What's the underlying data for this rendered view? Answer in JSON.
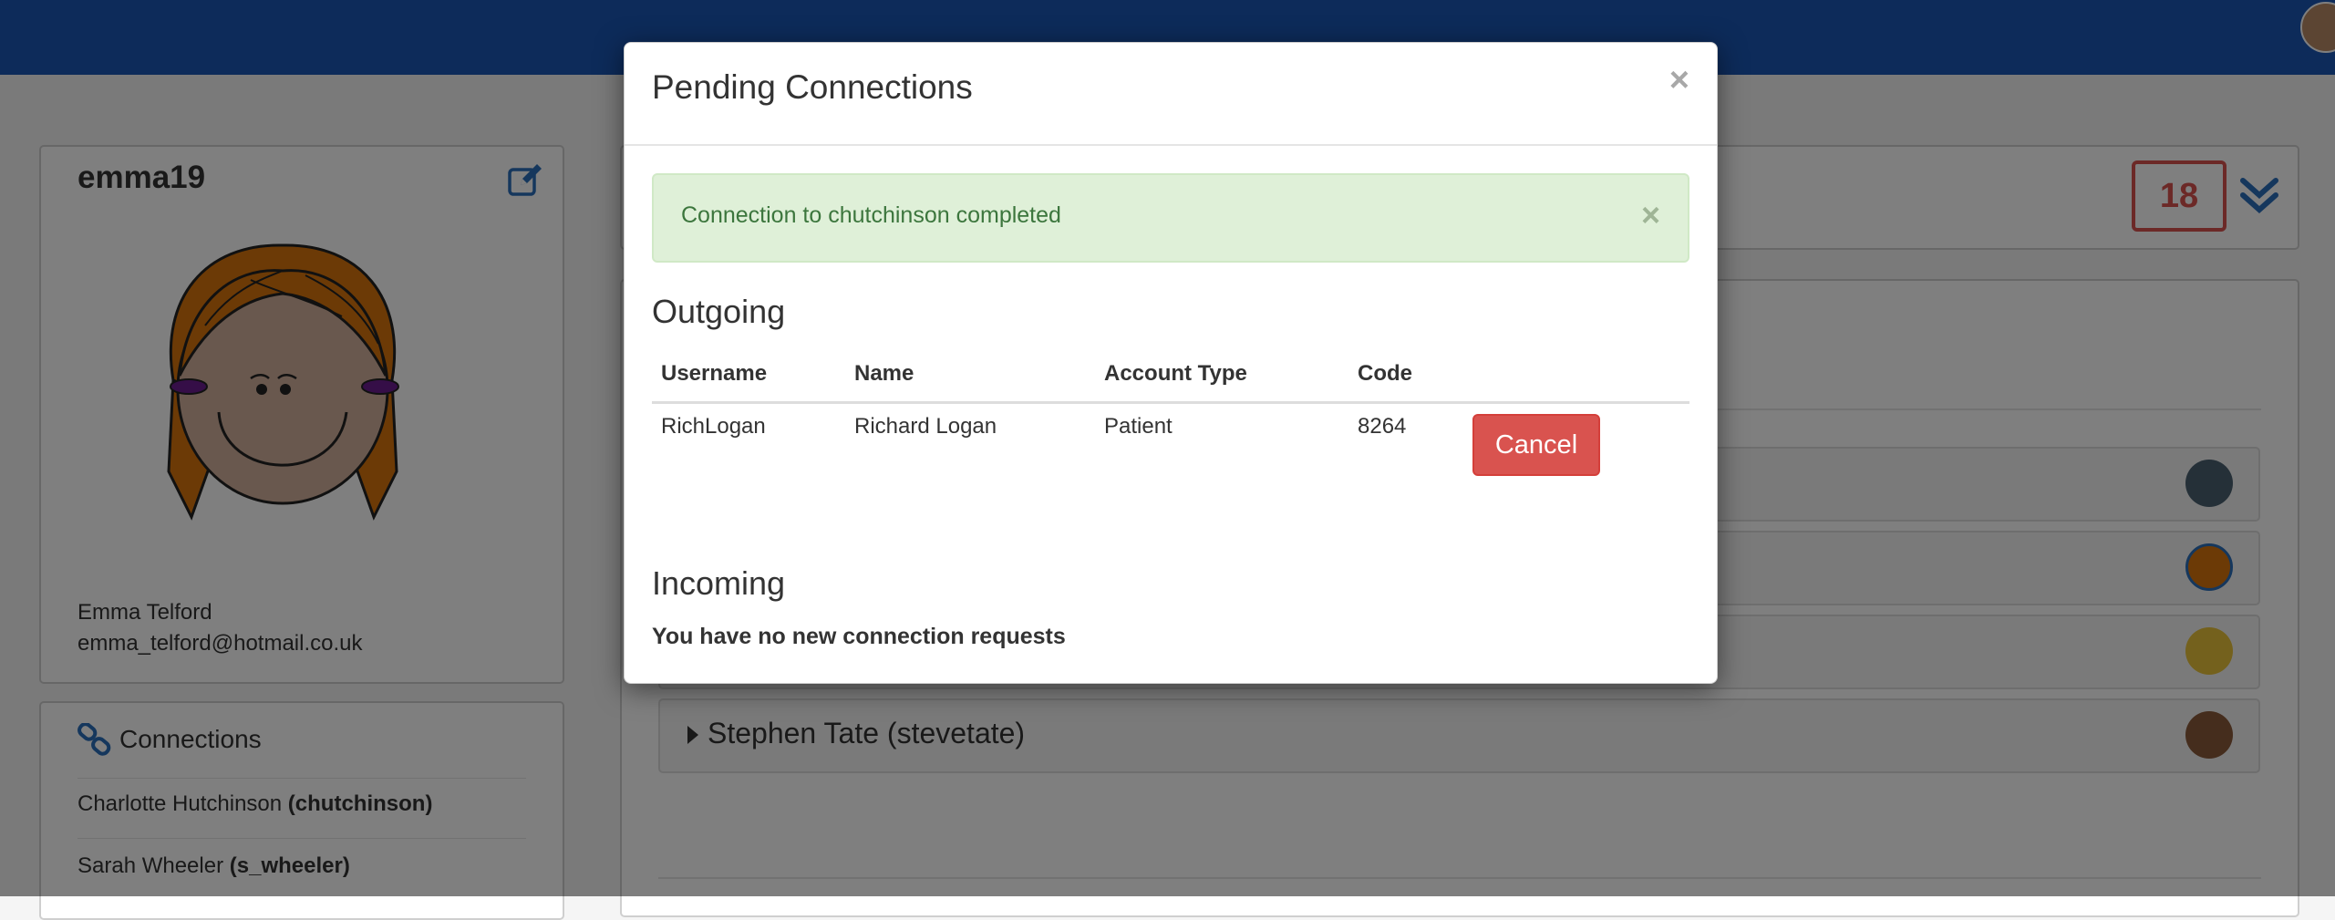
{
  "profile": {
    "username": "emma19",
    "full_name": "Emma Telford",
    "email": "emma_telford@hotmail.co.uk"
  },
  "connections": {
    "title": "Connections",
    "items": [
      {
        "name": "Charlotte Hutchinson",
        "handle": "(chutchinson)"
      },
      {
        "name": "Sarah Wheeler",
        "handle": "(s_wheeler)"
      }
    ]
  },
  "header": {
    "badge_count": "18"
  },
  "accordion": {
    "items": [
      {
        "label": ""
      },
      {
        "label": ""
      },
      {
        "label": ""
      },
      {
        "label": "Stephen Tate (stevetate)"
      }
    ]
  },
  "modal": {
    "title": "Pending Connections",
    "close_glyph": "×",
    "alert": {
      "message": "Connection to chutchinson completed",
      "close_glyph": "×"
    },
    "outgoing": {
      "heading": "Outgoing",
      "columns": [
        "Username",
        "Name",
        "Account Type",
        "Code"
      ],
      "rows": [
        {
          "username": "RichLogan",
          "name": "Richard Logan",
          "account_type": "Patient",
          "code": "8264",
          "action_label": "Cancel"
        }
      ]
    },
    "incoming": {
      "heading": "Incoming",
      "empty_message": "You have no new connection requests"
    }
  },
  "colors": {
    "topbar": "#1b56b4",
    "link_blue": "#2a6ebb",
    "danger": "#d9534f",
    "success_bg": "#dff0d8",
    "success_text": "#3c763d"
  },
  "icons": {
    "edit": "edit-icon",
    "link": "link-icon",
    "chevron": "chevron-double-down-icon",
    "caret": "caret-right-icon",
    "close": "close-icon"
  }
}
